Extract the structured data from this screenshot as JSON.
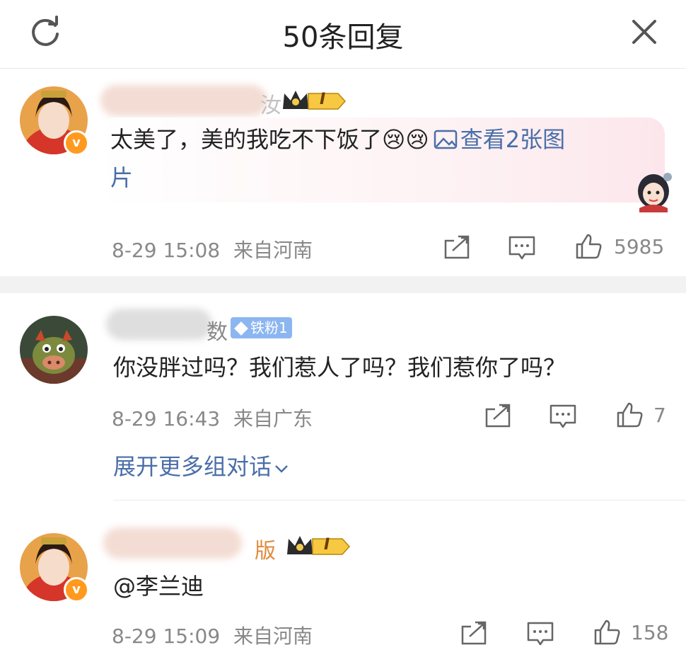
{
  "header": {
    "title": "50条回复"
  },
  "comments": [
    {
      "name_suffix": "汝",
      "level": "I",
      "text": "太美了，美的我吃不下饭了",
      "emoji": [
        "😢",
        "😢"
      ],
      "image_link": "查看2张图片",
      "image_link_line1": "查看2张图",
      "image_link_line2": "片",
      "time": "8-29 15:08",
      "location": "来自河南",
      "likes": "5985"
    },
    {
      "name_suffix": "数",
      "fan_badge": "铁粉1",
      "text": "你没胖过吗？我们惹人了吗？我们惹你了吗？",
      "time": "8-29 16:43",
      "location": "来自广东",
      "likes": "7"
    },
    {
      "name_suffix": "版",
      "level": "I",
      "text": "@李兰迪",
      "time": "8-29 15:09",
      "location": "来自河南",
      "likes": "158"
    }
  ],
  "expand_label": "展开更多组对话",
  "verified_badge": "v",
  "colors": {
    "link": "#4a6ea9",
    "meta": "#888888",
    "verified": "#ff9a1f",
    "fan_badge": "#8cb6f0"
  }
}
